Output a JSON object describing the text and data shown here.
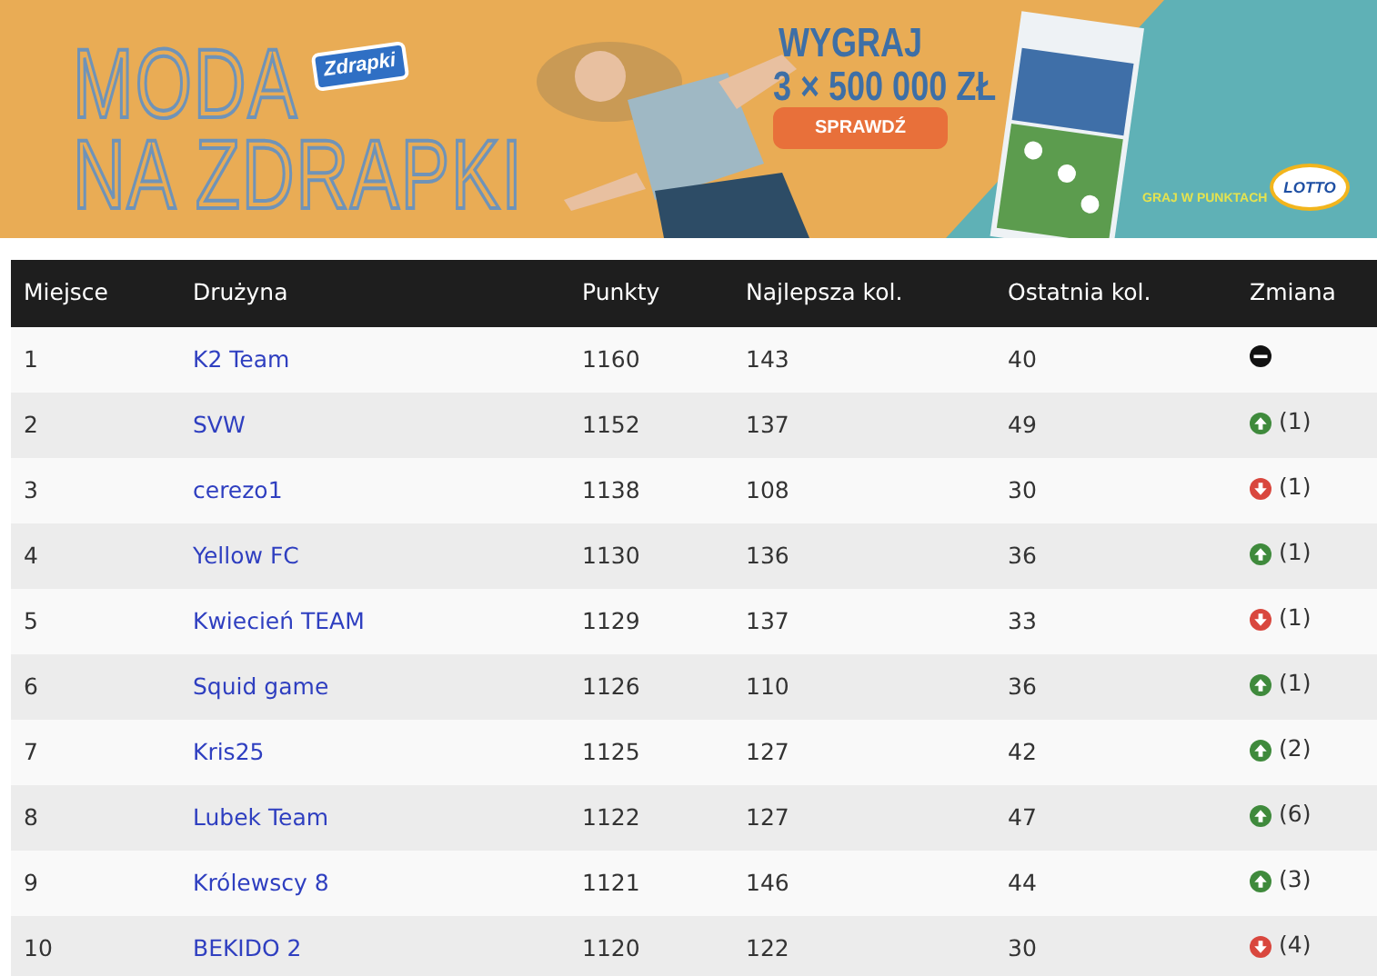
{
  "banner": {
    "headline_1": "MODA",
    "headline_2": "NA ZDRAPKI",
    "brand": "Zdrapki",
    "prize_line_1": "WYGRAJ",
    "prize_line_2": "3 × 500 000 ZŁ",
    "button": "SPRAWDŹ",
    "tagline": "GRAJ W PUNKTACH",
    "logo": "LOTTO"
  },
  "table": {
    "columns": [
      "Miejsce",
      "Drużyna",
      "Punkty",
      "Najlepsza kol.",
      "Ostatnia kol.",
      "Zmiana"
    ],
    "rows": [
      {
        "place": "1",
        "team": "K2 Team",
        "points": "1160",
        "best": "143",
        "last": "40",
        "change": {
          "kind": "same"
        }
      },
      {
        "place": "2",
        "team": "SVW",
        "points": "1152",
        "best": "137",
        "last": "49",
        "change": {
          "kind": "up",
          "text": "(1)"
        }
      },
      {
        "place": "3",
        "team": "cerezo1",
        "points": "1138",
        "best": "108",
        "last": "30",
        "change": {
          "kind": "down",
          "text": "(1)"
        }
      },
      {
        "place": "4",
        "team": "Yellow FC",
        "points": "1130",
        "best": "136",
        "last": "36",
        "change": {
          "kind": "up",
          "text": "(1)"
        }
      },
      {
        "place": "5",
        "team": "Kwiecień TEAM",
        "points": "1129",
        "best": "137",
        "last": "33",
        "change": {
          "kind": "down",
          "text": "(1)"
        }
      },
      {
        "place": "6",
        "team": "Squid game",
        "points": "1126",
        "best": "110",
        "last": "36",
        "change": {
          "kind": "up",
          "text": "(1)"
        }
      },
      {
        "place": "7",
        "team": "Kris25",
        "points": "1125",
        "best": "127",
        "last": "42",
        "change": {
          "kind": "up",
          "text": "(2)"
        }
      },
      {
        "place": "8",
        "team": "Lubek Team",
        "points": "1122",
        "best": "127",
        "last": "47",
        "change": {
          "kind": "up",
          "text": "(6)"
        }
      },
      {
        "place": "9",
        "team": "Królewscy 8",
        "points": "1121",
        "best": "146",
        "last": "44",
        "change": {
          "kind": "up",
          "text": "(3)"
        }
      },
      {
        "place": "10",
        "team": "BEKIDO 2",
        "points": "1120",
        "best": "122",
        "last": "30",
        "change": {
          "kind": "down",
          "text": "(4)"
        }
      }
    ]
  }
}
